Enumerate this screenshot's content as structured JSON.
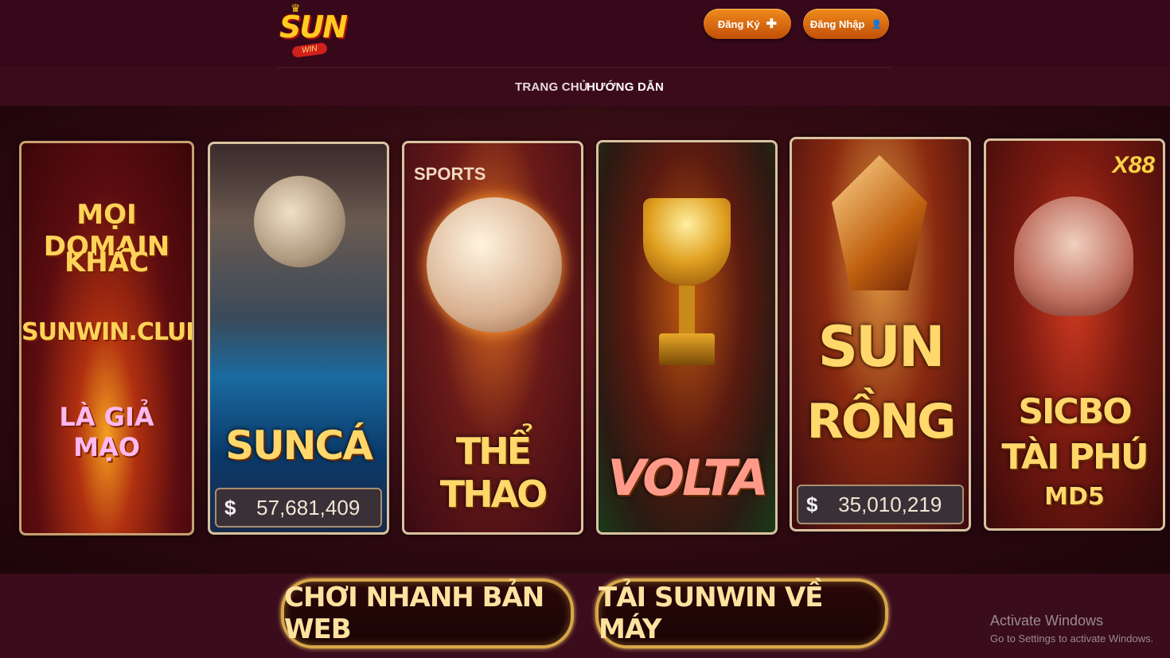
{
  "header": {
    "logo_text": "SUN",
    "logo_sub": "WIN",
    "register_label": "Đăng Ký",
    "login_label": "Đăng Nhập",
    "register_icon": "plus-icon",
    "login_icon": "user-icon"
  },
  "nav": {
    "home": "TRANG CHỦ",
    "guide": "HƯỚNG DẪN"
  },
  "cards": {
    "warning": {
      "line1": "MỌI DOMAIN",
      "line2": "KHÁC",
      "line3": "SUNWIN.CLUB",
      "line4": "LÀ GIẢ MẠO"
    },
    "suncas": {
      "title": "SUNCÁ",
      "jackpot_symbol": "$",
      "jackpot": "57,681,409"
    },
    "sports": {
      "badge": "SPORTS",
      "title": "THỂ THAO"
    },
    "volta": {
      "title": "VOLTA"
    },
    "sunrong": {
      "title_line1": "SUN",
      "title_line2": "RỒNG",
      "jackpot_symbol": "$",
      "jackpot": "35,010,219"
    },
    "sicbo": {
      "badge": "X88",
      "line1": "SICBO",
      "line2": "TÀI PHÚ",
      "line3": "MD5"
    }
  },
  "actions": {
    "play_web": "CHƠI NHANH BẢN WEB",
    "download": "TẢI SUNWIN VỀ MÁY"
  },
  "watermark": {
    "line1": "Activate Windows",
    "line2": "Go to Settings to activate Windows."
  },
  "colors": {
    "background": "#3a0c1c",
    "accent_orange": "#e87a18",
    "gold": "#ffd76a"
  }
}
